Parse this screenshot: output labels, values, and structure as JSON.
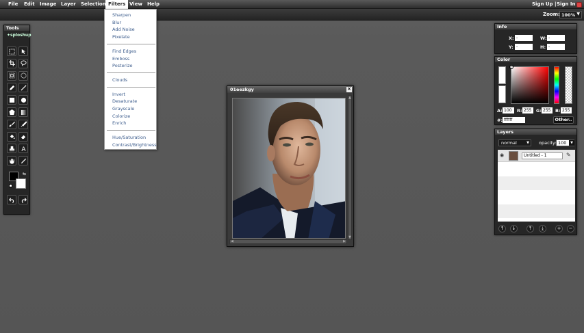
{
  "menubar": {
    "items": [
      "File",
      "Edit",
      "Image",
      "Layer",
      "Selection",
      "Filters",
      "View",
      "Help"
    ],
    "sign_up": "Sign Up |",
    "sign_in": "Sign In"
  },
  "zoom": {
    "label": "Zoom:",
    "value": "100%"
  },
  "tools_panel": {
    "title": "Tools",
    "logo": "sploshup",
    "icons": [
      "marquee-icon",
      "pointer-icon",
      "crop-icon",
      "lasso-icon",
      "rect-select-icon",
      "ellipse-select-icon",
      "pencil-icon",
      "line-icon",
      "rectangle-icon",
      "ellipse-icon",
      "polygon-icon",
      "gradient-icon",
      "brush-icon",
      "airbrush-icon",
      "fill-icon",
      "eraser-icon",
      "stamp-icon",
      "text-icon",
      "hand-icon",
      "eyedropper-icon"
    ],
    "fg_color": "#000000",
    "bg_color": "#ffffff"
  },
  "filters_menu": {
    "groups": [
      [
        "Sharpen",
        "Blur",
        "Add Noise",
        "Pixelate"
      ],
      [
        "Find Edges",
        "Emboss",
        "Posterize"
      ],
      [
        "Clouds"
      ],
      [
        "Invert",
        "Desaturate",
        "Grayscale",
        "Colorize",
        "Enrich"
      ],
      [
        "Hue/Saturation",
        "Contrast/Brightness"
      ]
    ]
  },
  "image_window": {
    "title": "01eezkgy"
  },
  "info_panel": {
    "title": "Info",
    "x_label": "X:",
    "y_label": "Y:",
    "w_label": "W:",
    "h_label": "H:",
    "x": "-",
    "y": "-",
    "w": "-",
    "h": "-"
  },
  "color_panel": {
    "title": "Color",
    "a_label": "A:",
    "a": "100",
    "r_label": "R:",
    "r": "255",
    "g_label": "G:",
    "g": "255",
    "b_label": "B:",
    "b": "255",
    "hash_label": "#:",
    "hex": "ffffff",
    "other_button": "Other.."
  },
  "layers_panel": {
    "title": "Layers",
    "blend_mode": "normal",
    "opacity_label": "opacity:",
    "opacity": "100",
    "layer_name": "Untitled - 1",
    "actions": [
      "↑",
      "↓",
      "⤒",
      "⤓",
      "+",
      "−"
    ]
  }
}
